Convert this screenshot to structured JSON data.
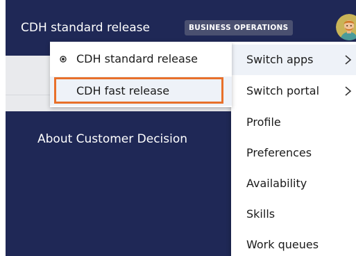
{
  "header": {
    "app_title": "CDH standard release",
    "badge": "BUSINESS OPERATIONS",
    "avatar_icon": "user-avatar-icon"
  },
  "main": {
    "heading": "About Customer Decision"
  },
  "app_switcher": {
    "items": [
      {
        "label": "CDH standard release",
        "current": true
      },
      {
        "label": "CDH fast release",
        "current": false
      }
    ],
    "highlight_color": "#e8702a"
  },
  "user_menu": {
    "items": [
      {
        "label": "Switch apps",
        "has_submenu": true
      },
      {
        "label": "Switch portal",
        "has_submenu": true
      },
      {
        "label": "Profile"
      },
      {
        "label": "Preferences"
      },
      {
        "label": "Availability"
      },
      {
        "label": "Skills"
      },
      {
        "label": "Work queues"
      }
    ]
  },
  "colors": {
    "header_bg": "#1f2856",
    "body_bg": "#1f2856",
    "menu_bg": "#ffffff",
    "hover_bg": "#eef2f8"
  }
}
